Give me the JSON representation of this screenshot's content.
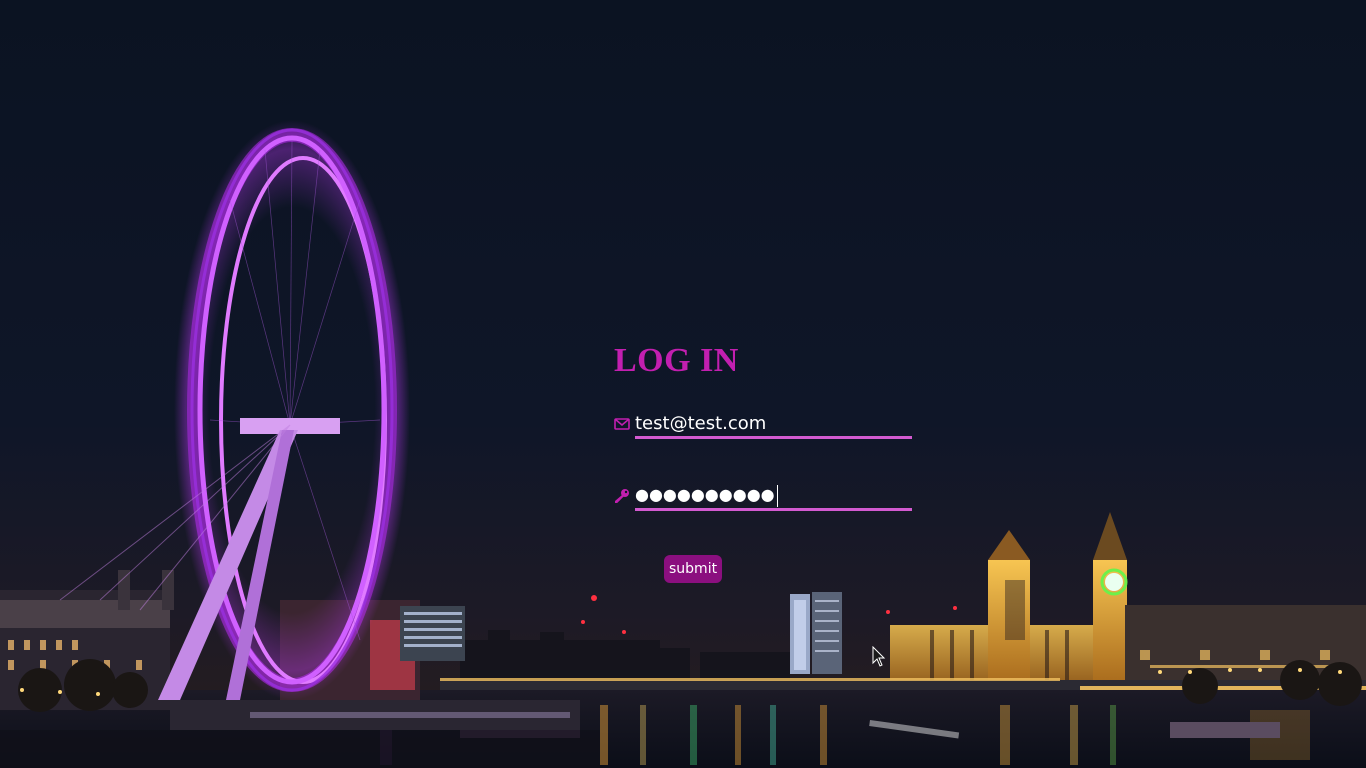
{
  "login": {
    "title": "LOG IN",
    "email_value": "test@test.com",
    "password_masked": "●●●●●●●●●●",
    "submit_label": "submit"
  },
  "icons": {
    "email": "envelope-icon",
    "password": "key-icon"
  },
  "colors": {
    "accent": "#c21fb0",
    "underline": "#d35ad0",
    "button_bg": "#8b0f7f",
    "sky": "#0c1424"
  },
  "background": {
    "scene": "night-city-skyline-with-ferris-wheel"
  }
}
